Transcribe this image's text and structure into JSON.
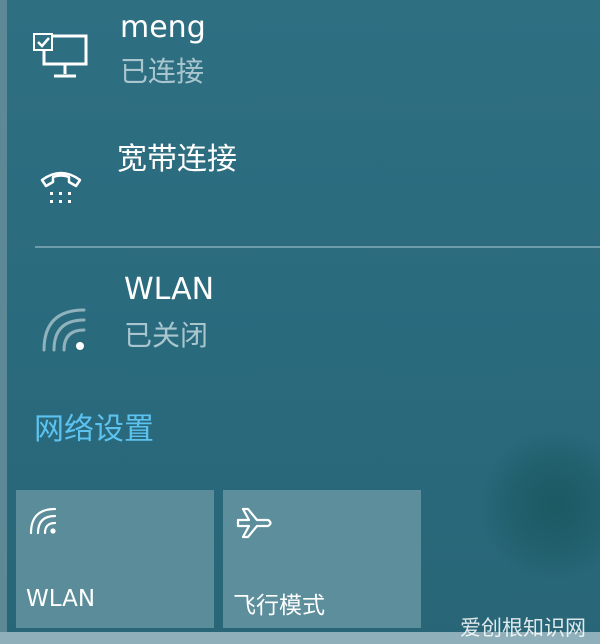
{
  "connections": [
    {
      "name": "meng",
      "status": "已连接",
      "icon": "computer-check-icon"
    },
    {
      "name": "宽带连接",
      "status": "",
      "icon": "dialup-phone-icon"
    },
    {
      "name": "WLAN",
      "status": "已关闭",
      "icon": "wifi-off-icon"
    }
  ],
  "network_settings_link": "网络设置",
  "quick_actions": [
    {
      "label": "WLAN",
      "icon": "wifi-icon"
    },
    {
      "label": "飞行模式",
      "icon": "airplane-icon"
    }
  ],
  "watermark": "爱创根知识网",
  "colors": {
    "panel_bg": "#2a6b7e",
    "link": "#5cc2ef",
    "tile_bg": "#5a8c9a"
  }
}
